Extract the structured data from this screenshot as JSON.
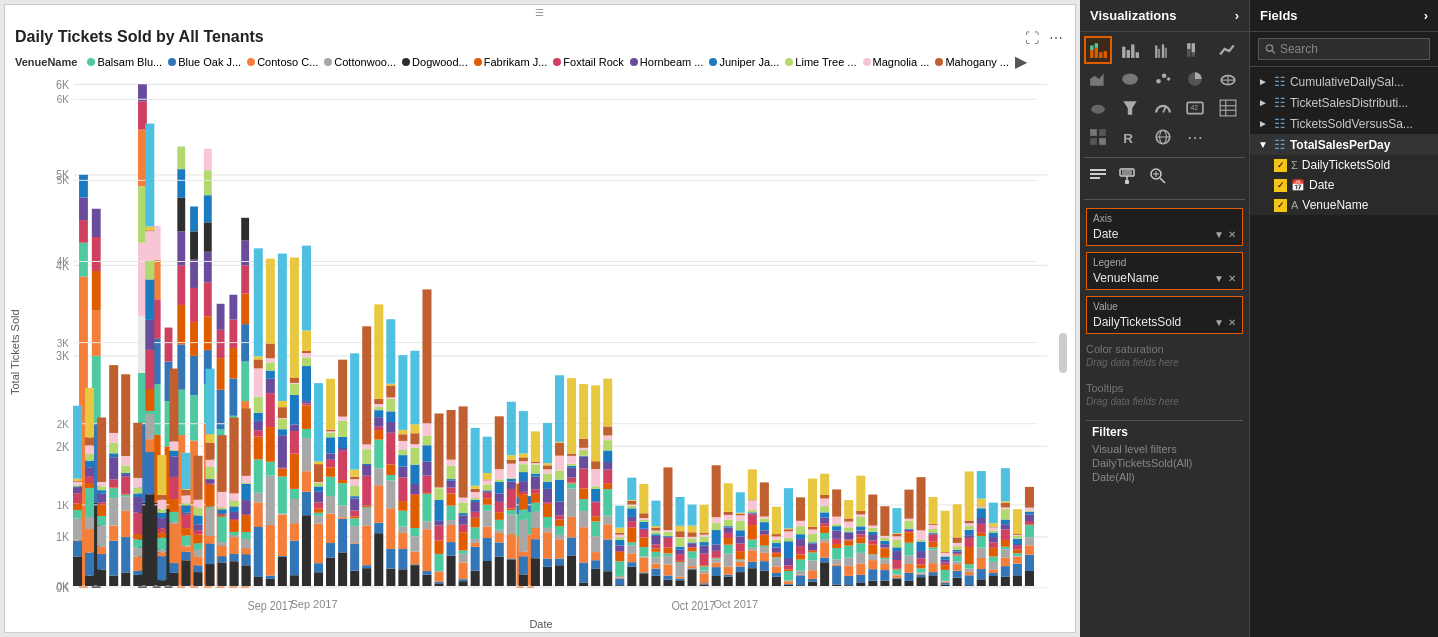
{
  "chart": {
    "title": "Daily Tickets Sold by All Tenants",
    "x_axis_label": "Date",
    "y_axis_label": "Total Tickets Sold",
    "y_ticks": [
      "6K",
      "5K",
      "4K",
      "3K",
      "2K",
      "1K",
      "0K"
    ],
    "x_ticks": [
      "Sep 2017",
      "Oct 2017"
    ],
    "legend_key": "VenueName",
    "legend_items": [
      {
        "label": "Balsam Blu...",
        "color": "#4ec9a0"
      },
      {
        "label": "Blue Oak J...",
        "color": "#3376b8"
      },
      {
        "label": "Contoso C...",
        "color": "#f47f3b"
      },
      {
        "label": "Cottonwoo...",
        "color": "#a8a8a8"
      },
      {
        "label": "Dogwood...",
        "color": "#2e2e2e"
      },
      {
        "label": "Fabrikam J...",
        "color": "#e05c00"
      },
      {
        "label": "Foxtail Rock",
        "color": "#d04060"
      },
      {
        "label": "Hornbeam ...",
        "color": "#6a4c9c"
      },
      {
        "label": "Juniper Ja...",
        "color": "#1c7ac0"
      },
      {
        "label": "Lime Tree ...",
        "color": "#b3d96e"
      },
      {
        "label": "Magnolia ...",
        "color": "#f7c6d4"
      },
      {
        "label": "Mahogany ...",
        "color": "#c06030"
      }
    ]
  },
  "visualizations_panel": {
    "header": "Visualizations",
    "chevron": "›",
    "format_icons": [
      "fields-icon",
      "format-icon",
      "analytics-icon"
    ],
    "axis_label": "Axis",
    "axis_value": "Date",
    "legend_label": "Legend",
    "legend_value": "VenueName",
    "value_label": "Value",
    "value_value": "DailyTicketsSold",
    "color_saturation_label": "Color saturation",
    "drag_hint_1": "Drag data fields here",
    "tooltips_label": "Tooltips",
    "drag_hint_2": "Drag data fields here",
    "filters_label": "Filters",
    "visual_level_label": "Visual level filters",
    "filter_1": "DailyTicketsSold(All)",
    "filter_2": "Date(All)"
  },
  "fields_panel": {
    "header": "Fields",
    "chevron": "›",
    "search_placeholder": "Search",
    "tables": [
      {
        "name": "CumulativeDailySal...",
        "expanded": false,
        "fields": []
      },
      {
        "name": "TicketSalesDistributi...",
        "expanded": false,
        "fields": []
      },
      {
        "name": "TicketsSoldVersusSa...",
        "expanded": false,
        "fields": []
      },
      {
        "name": "TotalSalesPerDay",
        "expanded": true,
        "fields": [
          {
            "name": "DailyTicketsSold",
            "checked": true,
            "type": "sigma"
          },
          {
            "name": "Date",
            "checked": true,
            "type": "date"
          },
          {
            "name": "VenueName",
            "checked": true,
            "type": "text"
          }
        ]
      }
    ]
  }
}
